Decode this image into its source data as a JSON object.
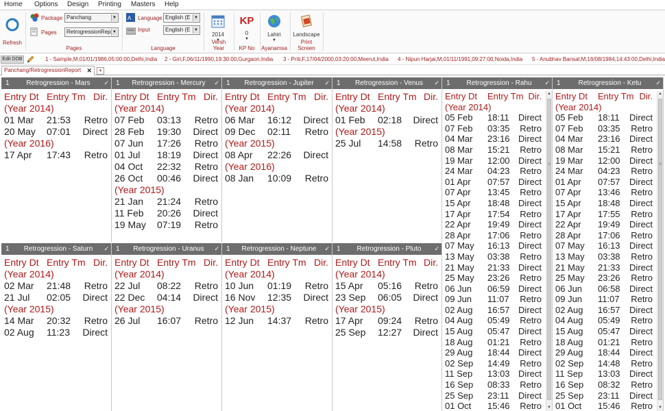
{
  "menu": [
    "Home",
    "Options",
    "Design",
    "Printing",
    "Masters",
    "Help"
  ],
  "ribbon": {
    "refresh_label": "Refresh",
    "package_label": "Package",
    "package_value": "Panchang",
    "pages_label": "Pages",
    "pages_value": "RetrogressionRepo",
    "pages_group": "Pages",
    "language_label": "Language",
    "language_value": "English (E",
    "input_label": "Input",
    "input_value": "English (E",
    "language_group": "Language",
    "versh_year_value": "2014",
    "versh_year_label": "Versh Year",
    "kp_value": "0",
    "kp_label": "KP No",
    "kp_icon_text": "KP",
    "ayanamsa_value": "Lahiri",
    "ayanamsa_label": "Ayanamsa",
    "print_value": "Landscape",
    "print_label": "Print Screen"
  },
  "dob_bar": {
    "edit_label": "Edit DOB",
    "items": [
      "1 - Sample,M,01/01/1986,05:00:00,Delhi,India",
      "2 - Girl,F,06/11/1990,19:30:00,Gurgaon,India",
      "3 - Priti,F,17/04/2000,03:20:00,Meerut,India",
      "4 - Nipun Harjai,M,01/11/1991,09:27:00,Noida,India",
      "5 - Anubhav Bansal,M,16/08/1984,14:43:00,Delhi,India"
    ]
  },
  "tab": {
    "label": "Panchang/RetrogressionReport",
    "close": "✕",
    "add": "+"
  },
  "columns": {
    "c1": "Entry Dt",
    "c2": "Entry Tm",
    "c3": "Dir."
  },
  "panels": [
    {
      "num": "1",
      "title": "Retrogression - Mars",
      "check": "✓",
      "rows": [
        {
          "year": "(Year 2014)"
        },
        {
          "d": "01 Mar",
          "t": "21:53",
          "dir": "Retro"
        },
        {
          "d": "20 May",
          "t": "07:01",
          "dir": "Direct"
        },
        {
          "year": "(Year 2016)"
        },
        {
          "d": "17 Apr",
          "t": "17:43",
          "dir": "Retro"
        }
      ]
    },
    {
      "num": "1",
      "title": "Retrogression - Mercury",
      "check": "✓",
      "rows": [
        {
          "year": "(Year 2014)"
        },
        {
          "d": "07 Feb",
          "t": "03:13",
          "dir": "Retro"
        },
        {
          "d": "28 Feb",
          "t": "19:30",
          "dir": "Direct"
        },
        {
          "d": "07 Jun",
          "t": "17:26",
          "dir": "Retro"
        },
        {
          "d": "01 Jul",
          "t": "18:19",
          "dir": "Direct"
        },
        {
          "d": "04 Oct",
          "t": "22:32",
          "dir": "Retro"
        },
        {
          "d": "26 Oct",
          "t": "00:46",
          "dir": "Direct"
        },
        {
          "year": "(Year 2015)"
        },
        {
          "d": "21 Jan",
          "t": "21:24",
          "dir": "Retro"
        },
        {
          "d": "11 Feb",
          "t": "20:26",
          "dir": "Direct"
        },
        {
          "d": "19 May",
          "t": "07:19",
          "dir": "Retro"
        }
      ]
    },
    {
      "num": "1",
      "title": "Retrogression - Jupiter",
      "check": "✓",
      "rows": [
        {
          "year": "(Year 2014)"
        },
        {
          "d": "06 Mar",
          "t": "16:12",
          "dir": "Direct"
        },
        {
          "d": "09 Dec",
          "t": "02:11",
          "dir": "Retro"
        },
        {
          "year": "(Year 2015)"
        },
        {
          "d": "08 Apr",
          "t": "22:26",
          "dir": "Direct"
        },
        {
          "year": "(Year 2016)"
        },
        {
          "d": "08 Jan",
          "t": "10:09",
          "dir": "Retro"
        }
      ]
    },
    {
      "num": "1",
      "title": "Retrogression - Venus",
      "check": "✓",
      "rows": [
        {
          "year": "(Year 2014)"
        },
        {
          "d": "01 Feb",
          "t": "02:18",
          "dir": "Direct"
        },
        {
          "year": "(Year 2015)"
        },
        {
          "d": "25 Jul",
          "t": "14:58",
          "dir": "Retro"
        }
      ]
    },
    {
      "num": "1",
      "title": "Retrogression - Rahu",
      "check": "✓",
      "tall": true,
      "rows": [
        {
          "year": "(Year 2014)"
        },
        {
          "d": "05 Feb",
          "t": "18:11",
          "dir": "Direct"
        },
        {
          "d": "07 Feb",
          "t": "03:35",
          "dir": "Retro"
        },
        {
          "d": "04 Mar",
          "t": "23:16",
          "dir": "Direct"
        },
        {
          "d": "08 Mar",
          "t": "15:21",
          "dir": "Retro"
        },
        {
          "d": "19 Mar",
          "t": "12:00",
          "dir": "Direct"
        },
        {
          "d": "24 Mar",
          "t": "04:23",
          "dir": "Retro"
        },
        {
          "d": "01 Apr",
          "t": "07:57",
          "dir": "Direct"
        },
        {
          "d": "07 Apr",
          "t": "13:45",
          "dir": "Retro"
        },
        {
          "d": "15 Apr",
          "t": "18:48",
          "dir": "Direct"
        },
        {
          "d": "17 Apr",
          "t": "17:54",
          "dir": "Retro"
        },
        {
          "d": "22 Apr",
          "t": "19:49",
          "dir": "Direct"
        },
        {
          "d": "28 Apr",
          "t": "17:06",
          "dir": "Retro"
        },
        {
          "d": "07 May",
          "t": "16:13",
          "dir": "Direct"
        },
        {
          "d": "13 May",
          "t": "03:38",
          "dir": "Retro"
        },
        {
          "d": "21 May",
          "t": "21:33",
          "dir": "Direct"
        },
        {
          "d": "25 May",
          "t": "23:26",
          "dir": "Retro"
        },
        {
          "d": "06 Jun",
          "t": "06:59",
          "dir": "Direct"
        },
        {
          "d": "09 Jun",
          "t": "11:07",
          "dir": "Retro"
        },
        {
          "d": "02 Aug",
          "t": "16:57",
          "dir": "Direct"
        },
        {
          "d": "04 Aug",
          "t": "05:49",
          "dir": "Retro"
        },
        {
          "d": "15 Aug",
          "t": "05:47",
          "dir": "Direct"
        },
        {
          "d": "18 Aug",
          "t": "01:21",
          "dir": "Retro"
        },
        {
          "d": "29 Aug",
          "t": "18:44",
          "dir": "Direct"
        },
        {
          "d": "02 Sep",
          "t": "14:49",
          "dir": "Retro"
        },
        {
          "d": "11 Sep",
          "t": "13:03",
          "dir": "Direct"
        },
        {
          "d": "16 Sep",
          "t": "08:33",
          "dir": "Retro"
        },
        {
          "d": "25 Sep",
          "t": "23:11",
          "dir": "Direct"
        },
        {
          "d": "01 Oct",
          "t": "15:46",
          "dir": "Retro"
        }
      ]
    },
    {
      "num": "1",
      "title": "Retrogression - Ketu",
      "check": "✓",
      "tall": true,
      "rows": [
        {
          "year": "(Year 2014)"
        },
        {
          "d": "05 Feb",
          "t": "18:11",
          "dir": "Direct"
        },
        {
          "d": "07 Feb",
          "t": "03:35",
          "dir": "Retro"
        },
        {
          "d": "04 Mar",
          "t": "23:16",
          "dir": "Direct"
        },
        {
          "d": "08 Mar",
          "t": "15:21",
          "dir": "Retro"
        },
        {
          "d": "19 Mar",
          "t": "12:00",
          "dir": "Direct"
        },
        {
          "d": "24 Mar",
          "t": "04:23",
          "dir": "Retro"
        },
        {
          "d": "01 Apr",
          "t": "07:57",
          "dir": "Direct"
        },
        {
          "d": "07 Apr",
          "t": "13:46",
          "dir": "Retro"
        },
        {
          "d": "15 Apr",
          "t": "18:48",
          "dir": "Direct"
        },
        {
          "d": "17 Apr",
          "t": "17:55",
          "dir": "Retro"
        },
        {
          "d": "22 Apr",
          "t": "19:49",
          "dir": "Direct"
        },
        {
          "d": "28 Apr",
          "t": "17:06",
          "dir": "Retro"
        },
        {
          "d": "07 May",
          "t": "16:13",
          "dir": "Direct"
        },
        {
          "d": "13 May",
          "t": "03:38",
          "dir": "Retro"
        },
        {
          "d": "21 May",
          "t": "21:33",
          "dir": "Direct"
        },
        {
          "d": "25 May",
          "t": "23:26",
          "dir": "Retro"
        },
        {
          "d": "06 Jun",
          "t": "06:58",
          "dir": "Direct"
        },
        {
          "d": "09 Jun",
          "t": "11:07",
          "dir": "Retro"
        },
        {
          "d": "02 Aug",
          "t": "16:57",
          "dir": "Direct"
        },
        {
          "d": "04 Aug",
          "t": "05:49",
          "dir": "Retro"
        },
        {
          "d": "15 Aug",
          "t": "05:47",
          "dir": "Direct"
        },
        {
          "d": "18 Aug",
          "t": "01:21",
          "dir": "Retro"
        },
        {
          "d": "29 Aug",
          "t": "18:44",
          "dir": "Direct"
        },
        {
          "d": "02 Sep",
          "t": "14:48",
          "dir": "Retro"
        },
        {
          "d": "11 Sep",
          "t": "13:03",
          "dir": "Direct"
        },
        {
          "d": "16 Sep",
          "t": "08:32",
          "dir": "Retro"
        },
        {
          "d": "25 Sep",
          "t": "23:11",
          "dir": "Direct"
        },
        {
          "d": "01 Oct",
          "t": "15:46",
          "dir": "Retro"
        }
      ]
    },
    {
      "num": "1",
      "title": "Retrogression - Saturn",
      "check": "✓",
      "rows": [
        {
          "year": "(Year 2014)"
        },
        {
          "d": "02 Mar",
          "t": "21:48",
          "dir": "Retro"
        },
        {
          "d": "21 Jul",
          "t": "02:05",
          "dir": "Direct"
        },
        {
          "year": "(Year 2015)"
        },
        {
          "d": "14 Mar",
          "t": "20:32",
          "dir": "Retro"
        },
        {
          "d": "02 Aug",
          "t": "11:23",
          "dir": "Direct"
        }
      ]
    },
    {
      "num": "1",
      "title": "Retrogression - Uranus",
      "check": "✓",
      "rows": [
        {
          "year": "(Year 2014)"
        },
        {
          "d": "22 Jul",
          "t": "08:22",
          "dir": "Retro"
        },
        {
          "d": "22 Dec",
          "t": "04:14",
          "dir": "Direct"
        },
        {
          "year": "(Year 2015)"
        },
        {
          "d": "26 Jul",
          "t": "16:07",
          "dir": "Retro"
        }
      ]
    },
    {
      "num": "1",
      "title": "Retrogression - Neptune",
      "check": "✓",
      "rows": [
        {
          "year": "(Year 2014)"
        },
        {
          "d": "10 Jun",
          "t": "01:19",
          "dir": "Retro"
        },
        {
          "d": "16 Nov",
          "t": "12:35",
          "dir": "Direct"
        },
        {
          "year": "(Year 2015)"
        },
        {
          "d": "12 Jun",
          "t": "14:37",
          "dir": "Retro"
        }
      ]
    },
    {
      "num": "1",
      "title": "Retrogression - Pluto",
      "check": "✓",
      "rows": [
        {
          "year": "(Year 2014)"
        },
        {
          "d": "15 Apr",
          "t": "05:16",
          "dir": "Retro"
        },
        {
          "d": "23 Sep",
          "t": "06:05",
          "dir": "Direct"
        },
        {
          "year": "(Year 2015)"
        },
        {
          "d": "17 Apr",
          "t": "09:24",
          "dir": "Retro"
        },
        {
          "d": "25 Sep",
          "t": "12:27",
          "dir": "Direct"
        }
      ]
    }
  ],
  "colors": {
    "accent": "#b01818",
    "panel_header": "#6d6d6d"
  }
}
